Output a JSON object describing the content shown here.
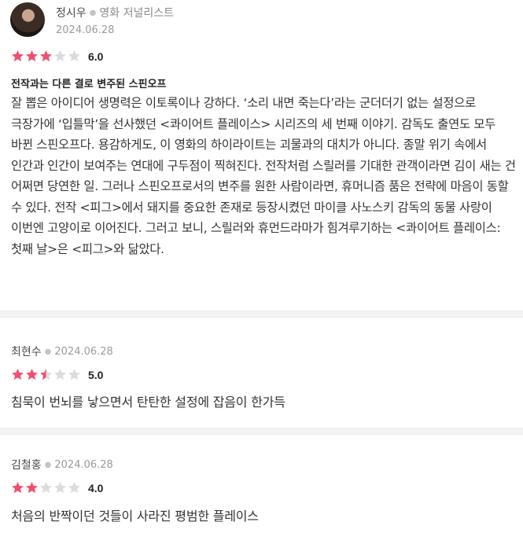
{
  "reviews": [
    {
      "author": "정시우",
      "job": "영화 저널리스트",
      "date": "2024.06.28",
      "stars_filled": 3,
      "score": "6.0",
      "title": "전작과는 다른 결로 변주된 스핀오프",
      "body": "잘 뽑은 아이디어 생명력은 이토록이나 강하다. ‘소리 내면 죽는다’라는 군더더기 없는 설정으로 극장가에 ‘입틀막’을 선사했던 <콰이어트 플레이스> 시리즈의 세 번째 이야기. 감독도 출연도 모두 바뀐 스핀오프다. 용감하게도, 이 영화의 하이라이트는 괴물과의 대치가 아니다. 종말 위기 속에서 인간과 인간이 보여주는 연대에 구두점이 찍혀진다. 전작처럼 스릴러를 기대한 관객이라면 김이 새는 건 어쩌면 당연한 일. 그러나 스핀오프로서의 변주를 원한 사람이라면, 휴머니즘 품은 전략에 마음이 동할 수 있다. 전작 <피그>에서 돼지를 중요한 존재로 등장시켰던 마이클 사노스키 감독의 동물 사랑이 이번엔 고양이로 이어진다. 그러고 보니, 스릴러와 휴먼드라마가 힘겨루기하는 <콰이어트 플레이스: 첫째 날>은 <피그>와 닮았다."
    },
    {
      "author": "최현수",
      "date": "2024.06.28",
      "stars_filled": 2.5,
      "score": "5.0",
      "body": "침묵이 번뇌를 낳으면서 탄탄한 설정에 잡음이 한가득"
    },
    {
      "author": "김철홍",
      "date": "2024.06.28",
      "stars_filled": 2,
      "score": "4.0",
      "body": "처음의 반짝이던 것들이 사라진 평범한 플레이스"
    }
  ],
  "colors": {
    "star_on": "#f0506e",
    "star_off": "#dcdcdc"
  },
  "icons": {
    "avatar": "avatar-photo",
    "star": "star-icon"
  }
}
